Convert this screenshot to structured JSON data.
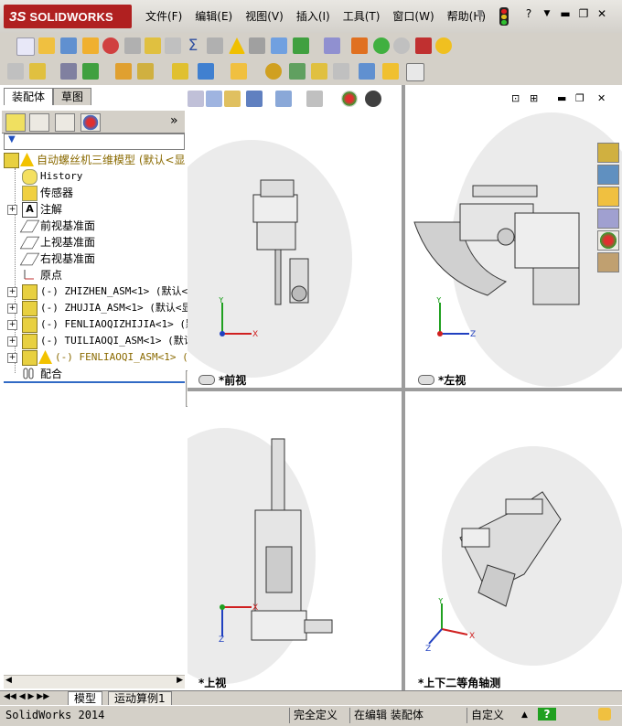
{
  "app": {
    "logo_ds": "3S",
    "logo_text": "SOLIDWORKS"
  },
  "menu": [
    "文件(F)",
    "编辑(E)",
    "视图(V)",
    "插入(I)",
    "工具(T)",
    "窗口(W)",
    "帮助(H)"
  ],
  "window_buttons": {
    "help": "?",
    "min": "▬",
    "restore": "❐",
    "close": "✕"
  },
  "panel": {
    "tabs": [
      "装配体",
      "草图"
    ],
    "expand": "»",
    "filter": "▼"
  },
  "tree": {
    "root": "自动螺丝机三维模型 (默认<显",
    "items": [
      {
        "label": "History",
        "icon": "history-icon"
      },
      {
        "label": "传感器",
        "icon": "sensor-icon"
      },
      {
        "label": "注解",
        "icon": "annotation-icon"
      },
      {
        "label": "前视基准面",
        "icon": "plane-icon"
      },
      {
        "label": "上视基准面",
        "icon": "plane-icon"
      },
      {
        "label": "右视基准面",
        "icon": "plane-icon"
      },
      {
        "label": "原点",
        "icon": "origin-icon"
      },
      {
        "label": "(-) ZHIZHEN_ASM<1> (默认<显",
        "icon": "subassembly-icon"
      },
      {
        "label": "(-) ZHUJIA_ASM<1> (默认<显",
        "icon": "subassembly-icon"
      },
      {
        "label": "(-) FENLIAOQIZHIJIA<1> (默认",
        "icon": "subassembly-icon"
      },
      {
        "label": "(-) TUILIAOQI_ASM<1> (默认<",
        "icon": "subassembly-icon"
      },
      {
        "label": "(-) FENLIAOQI_ASM<1> (默",
        "icon": "subassembly-warning-icon"
      },
      {
        "label": "配合",
        "icon": "mates-icon"
      }
    ]
  },
  "viewports": [
    {
      "label": "*前视",
      "axes": [
        "Y",
        "X"
      ]
    },
    {
      "label": "*左视",
      "axes": [
        "Y",
        "Z"
      ]
    },
    {
      "label": "*上视",
      "axes": [
        "X",
        "Z"
      ]
    },
    {
      "label": "*上下二等角轴测",
      "axes": [
        "Y",
        "X",
        "Z"
      ]
    }
  ],
  "bottom_tabs": [
    "模型",
    "运动算例1"
  ],
  "status": {
    "app_version": "SolidWorks 2014",
    "state": "完全定义",
    "editing": "在编辑 装配体",
    "custom": "自定义",
    "help": "?"
  },
  "colors": {
    "accent": "#316ac5",
    "warning": "#f2c200",
    "brand": "#b02020"
  }
}
